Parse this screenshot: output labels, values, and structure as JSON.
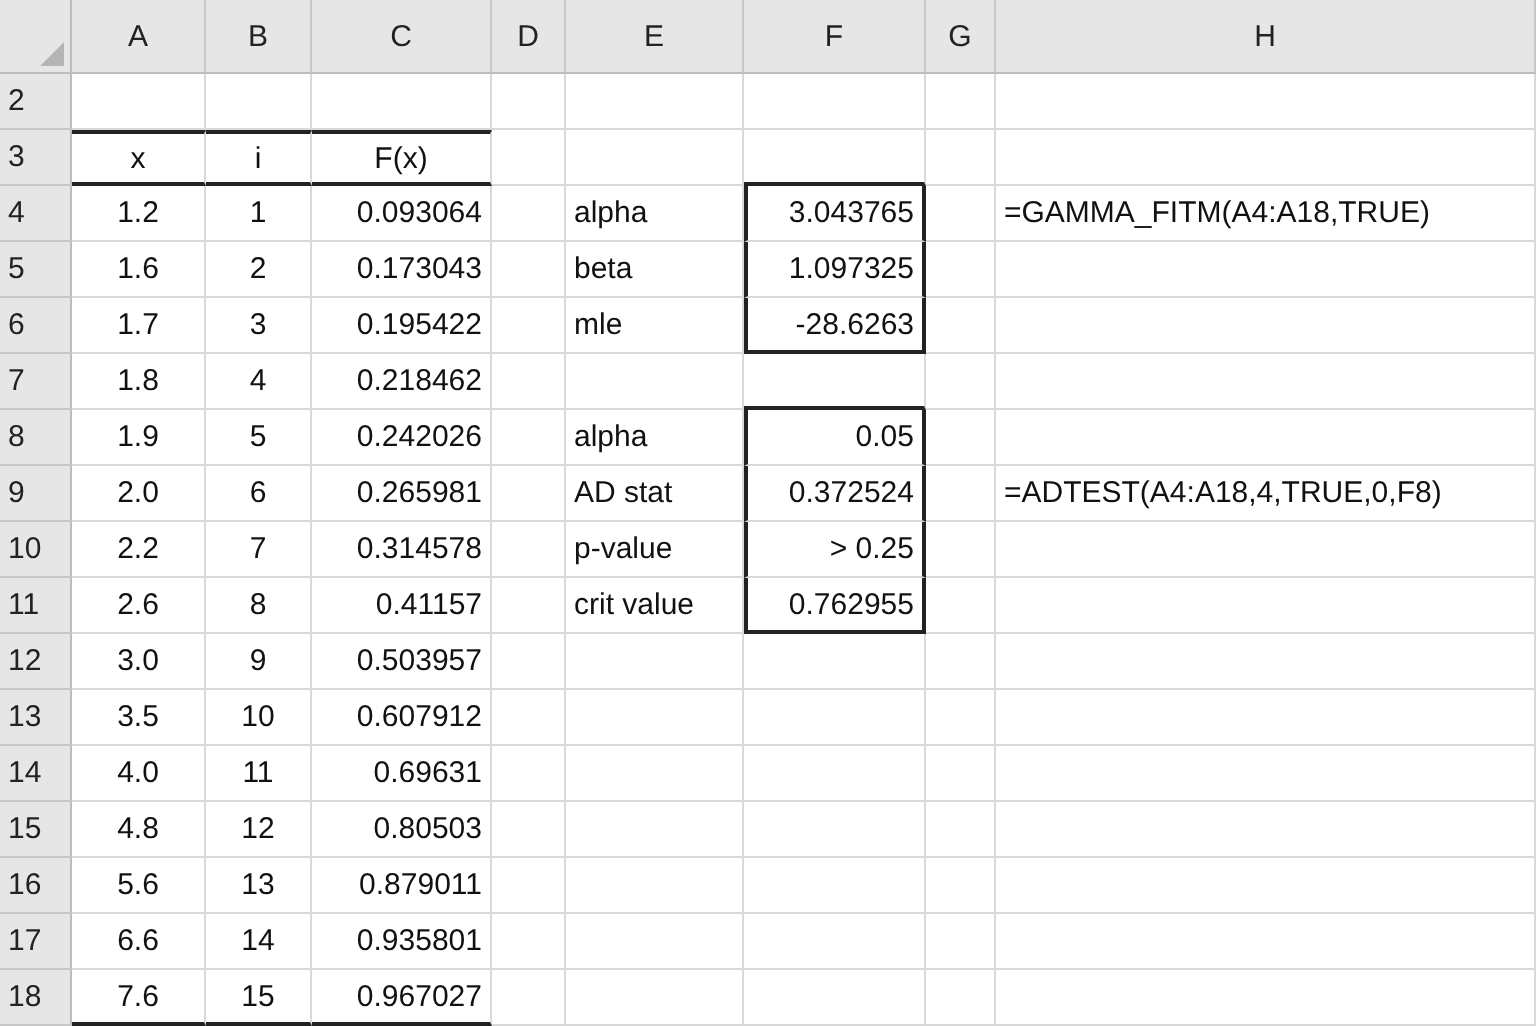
{
  "column_headers": [
    "A",
    "B",
    "C",
    "D",
    "E",
    "F",
    "G",
    "H"
  ],
  "rows": [
    {
      "number": "2",
      "cells": {}
    },
    {
      "number": "3",
      "cells": {
        "a": "x",
        "b": "i",
        "c": "F(x)"
      }
    },
    {
      "number": "4",
      "cells": {
        "a": "1.2",
        "b": "1",
        "c": "0.093064",
        "e": "alpha",
        "f": "3.043765",
        "h": "=GAMMA_FITM(A4:A18,TRUE)"
      }
    },
    {
      "number": "5",
      "cells": {
        "a": "1.6",
        "b": "2",
        "c": "0.173043",
        "e": "beta",
        "f": "1.097325"
      }
    },
    {
      "number": "6",
      "cells": {
        "a": "1.7",
        "b": "3",
        "c": "0.195422",
        "e": "mle",
        "f": "-28.6263"
      }
    },
    {
      "number": "7",
      "cells": {
        "a": "1.8",
        "b": "4",
        "c": "0.218462"
      }
    },
    {
      "number": "8",
      "cells": {
        "a": "1.9",
        "b": "5",
        "c": "0.242026",
        "e": "alpha",
        "f": "0.05"
      }
    },
    {
      "number": "9",
      "cells": {
        "a": "2.0",
        "b": "6",
        "c": "0.265981",
        "e": "AD stat",
        "f": "0.372524",
        "h": "=ADTEST(A4:A18,4,TRUE,0,F8)"
      }
    },
    {
      "number": "10",
      "cells": {
        "a": "2.2",
        "b": "7",
        "c": "0.314578",
        "e": "p-value",
        "f": "> 0.25"
      }
    },
    {
      "number": "11",
      "cells": {
        "a": "2.6",
        "b": "8",
        "c": "0.41157",
        "e": "crit value",
        "f": "0.762955"
      }
    },
    {
      "number": "12",
      "cells": {
        "a": "3.0",
        "b": "9",
        "c": "0.503957"
      }
    },
    {
      "number": "13",
      "cells": {
        "a": "3.5",
        "b": "10",
        "c": "0.607912"
      }
    },
    {
      "number": "14",
      "cells": {
        "a": "4.0",
        "b": "11",
        "c": "0.69631"
      }
    },
    {
      "number": "15",
      "cells": {
        "a": "4.8",
        "b": "12",
        "c": "0.80503"
      }
    },
    {
      "number": "16",
      "cells": {
        "a": "5.6",
        "b": "13",
        "c": "0.879011"
      }
    },
    {
      "number": "17",
      "cells": {
        "a": "6.6",
        "b": "14",
        "c": "0.935801"
      }
    },
    {
      "number": "18",
      "cells": {
        "a": "7.6",
        "b": "15",
        "c": "0.967027"
      }
    }
  ]
}
